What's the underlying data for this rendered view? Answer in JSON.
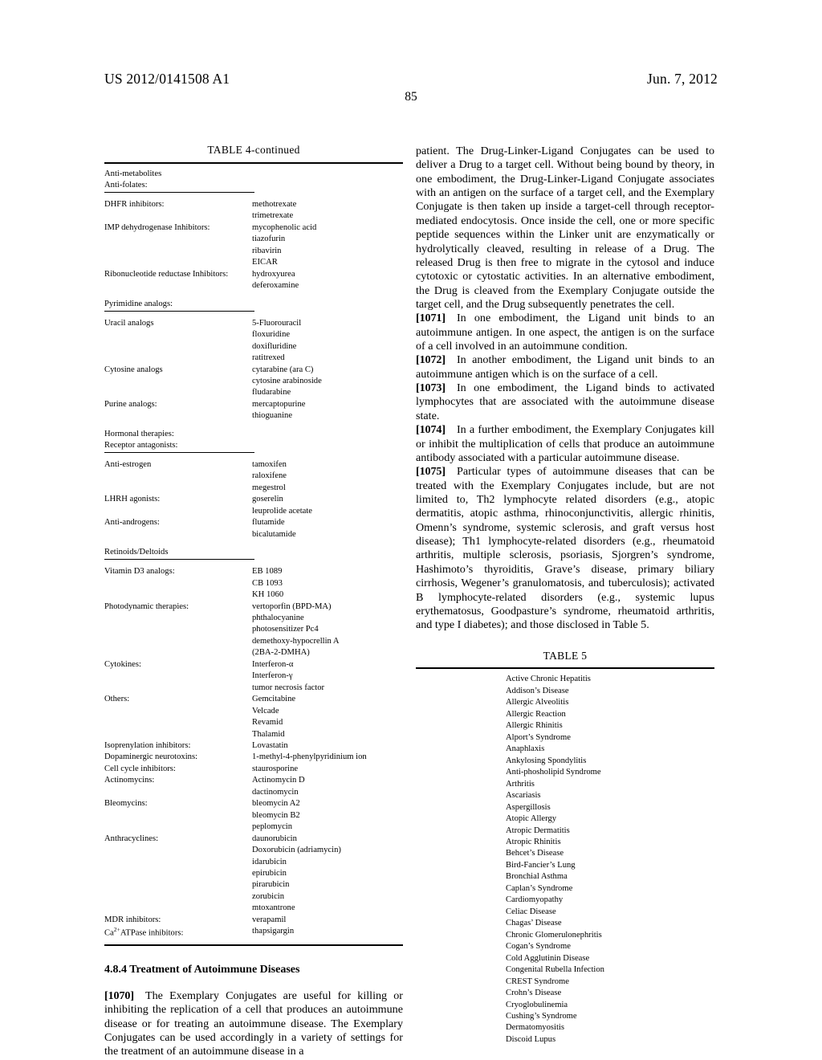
{
  "header": {
    "publication_number": "US 2012/0141508 A1",
    "date": "Jun. 7, 2012",
    "page_number": "85"
  },
  "left_column": {
    "table4": {
      "caption": "TABLE 4-continued",
      "groups": [
        {
          "head": [
            "Anti-metabolites",
            "Anti-folates:"
          ],
          "rows": [
            {
              "label": "DHFR inhibitors:",
              "values": [
                "methotrexate",
                "trimetrexate"
              ]
            },
            {
              "label": "IMP dehydrogenase Inhibitors:",
              "values": [
                "mycophenolic acid",
                "tiazofurin",
                "ribavirin",
                "EICAR"
              ]
            },
            {
              "label": "Ribonucleotide reductase Inhibitors:",
              "values": [
                "hydroxyurea",
                "deferoxamine"
              ]
            }
          ]
        },
        {
          "head": [
            "Pyrimidine analogs:"
          ],
          "rows": [
            {
              "label": "Uracil analogs",
              "values": [
                "5-Fluorouracil",
                "floxuridine",
                "doxifluridine",
                "ratitrexed"
              ]
            },
            {
              "label": "Cytosine analogs",
              "values": [
                "cytarabine (ara C)",
                "cytosine arabinoside",
                "fludarabine"
              ]
            },
            {
              "label": "Purine analogs:",
              "values": [
                "mercaptopurine",
                "thioguanine"
              ]
            }
          ]
        },
        {
          "head": [
            "Hormonal therapies:",
            "Receptor antagonists:"
          ],
          "rows": [
            {
              "label": "Anti-estrogen",
              "values": [
                "tamoxifen",
                "raloxifene",
                "megestrol"
              ]
            },
            {
              "label": "LHRH agonists:",
              "values": [
                "goserelin",
                "leuprolide acetate"
              ]
            },
            {
              "label": "Anti-androgens:",
              "values": [
                "flutamide",
                "bicalutamide"
              ]
            }
          ]
        },
        {
          "head": [
            "Retinoids/Deltoids"
          ],
          "rows": [
            {
              "label": "Vitamin D3 analogs:",
              "values": [
                "EB 1089",
                "CB 1093",
                "KH 1060"
              ]
            },
            {
              "label": "Photodynamic therapies:",
              "values": [
                "vertoporfin (BPD-MA)",
                "phthalocyanine",
                "photosensitizer Pc4",
                "demethoxy-hypocrellin A",
                "(2BA-2-DMHA)"
              ]
            },
            {
              "label": "Cytokines:",
              "values": [
                "Interferon-α",
                "Interferon-γ",
                "tumor necrosis factor"
              ]
            },
            {
              "label": "Others:",
              "values": [
                "Gemcitabine",
                "Velcade",
                "Revamid",
                "Thalamid"
              ]
            },
            {
              "label": "Isoprenylation inhibitors:",
              "values": [
                "Lovastatin"
              ]
            },
            {
              "label": "Dopaminergic neurotoxins:",
              "values": [
                "1-methyl-4-phenylpyridinium ion"
              ]
            },
            {
              "label": "Cell cycle inhibitors:",
              "values": [
                "staurosporine"
              ]
            },
            {
              "label": "Actinomycins:",
              "values": [
                "Actinomycin D",
                "dactinomycin"
              ]
            },
            {
              "label": "Bleomycins:",
              "values": [
                "bleomycin A2",
                "bleomycin B2",
                "peplomycin"
              ]
            },
            {
              "label": "Anthracyclines:",
              "values": [
                "daunorubicin",
                "Doxorubicin (adriamycin)",
                "idarubicin",
                "epirubicin",
                "pirarubicin",
                "zorubicin",
                "mtoxantrone"
              ]
            },
            {
              "label": "MDR inhibitors:",
              "values": [
                "verapamil"
              ]
            },
            {
              "label": "Ca2+ATPase inhibitors:",
              "label_base": "Ca",
              "label_sup": "2+",
              "label_tail": "ATPase inhibitors:",
              "values": [
                "thapsigargin"
              ]
            }
          ]
        }
      ]
    },
    "section_heading": "4.8.4 Treatment of Autoimmune Diseases",
    "paragraph_1070": {
      "number": "[1070]",
      "text": "The Exemplary Conjugates are useful for killing or inhibiting the replication of a cell that produces an autoimmune disease or for treating an autoimmune disease. The Exemplary Conjugates can be used accordingly in a variety of settings for the treatment of an autoimmune disease in a"
    }
  },
  "right_column": {
    "continued_paragraph": "patient. The Drug-Linker-Ligand Conjugates can be used to deliver a Drug to a target cell. Without being bound by theory, in one embodiment, the Drug-Linker-Ligand Conjugate associates with an antigen on the surface of a target cell, and the Exemplary Conjugate is then taken up inside a target-cell through receptor-mediated endocytosis. Once inside the cell, one or more specific peptide sequences within the Linker unit are enzymatically or hydrolytically cleaved, resulting in release of a Drug. The released Drug is then free to migrate in the cytosol and induce cytotoxic or cytostatic activities. In an alternative embodiment, the Drug is cleaved from the Exemplary Conjugate outside the target cell, and the Drug subsequently penetrates the cell.",
    "paragraphs": [
      {
        "number": "[1071]",
        "text": "In one embodiment, the Ligand unit binds to an autoimmune antigen. In one aspect, the antigen is on the surface of a cell involved in an autoimmune condition."
      },
      {
        "number": "[1072]",
        "text": "In another embodiment, the Ligand unit binds to an autoimmune antigen which is on the surface of a cell."
      },
      {
        "number": "[1073]",
        "text": "In one embodiment, the Ligand binds to activated lymphocytes that are associated with the autoimmune disease state."
      },
      {
        "number": "[1074]",
        "text": "In a further embodiment, the Exemplary Conjugates kill or inhibit the multiplication of cells that produce an autoimmune antibody associated with a particular autoimmune disease."
      },
      {
        "number": "[1075]",
        "text": "Particular types of autoimmune diseases that can be treated with the Exemplary Conjugates include, but are not limited to, Th2 lymphocyte related disorders (e.g., atopic dermatitis, atopic asthma, rhinoconjunctivitis, allergic rhinitis, Omenn’s syndrome, systemic sclerosis, and graft versus host disease); Th1 lymphocyte-related disorders (e.g., rheumatoid arthritis, multiple sclerosis, psoriasis, Sjorgren’s syndrome, Hashimoto’s thyroiditis, Grave’s disease, primary biliary cirrhosis, Wegener’s granulomatosis, and tuberculosis); activated B lymphocyte-related disorders (e.g., systemic lupus erythematosus, Goodpasture’s syndrome, rheumatoid arthritis, and type I diabetes); and those disclosed in Table 5."
      }
    ],
    "table5": {
      "caption": "TABLE 5",
      "items": [
        "Active Chronic Hepatitis",
        "Addison’s Disease",
        "Allergic Alveolitis",
        "Allergic Reaction",
        "Allergic Rhinitis",
        "Alport’s Syndrome",
        "Anaphlaxis",
        "Ankylosing Spondylitis",
        "Anti-phosholipid Syndrome",
        "Arthritis",
        "Ascariasis",
        "Aspergillosis",
        "Atopic Allergy",
        "Atropic Dermatitis",
        "Atropic Rhinitis",
        "Behcet’s Disease",
        "Bird-Fancier’s Lung",
        "Bronchial Asthma",
        "Caplan’s Syndrome",
        "Cardiomyopathy",
        "Celiac Disease",
        "Chagas’ Disease",
        "Chronic Glomerulonephritis",
        "Cogan’s Syndrome",
        "Cold Agglutinin Disease",
        "Congenital Rubella Infection",
        "CREST Syndrome",
        "Crohn’s Disease",
        "Cryoglobulinemia",
        "Cushing’s Syndrome",
        "Dermatomyositis",
        "Discoid Lupus"
      ]
    }
  }
}
